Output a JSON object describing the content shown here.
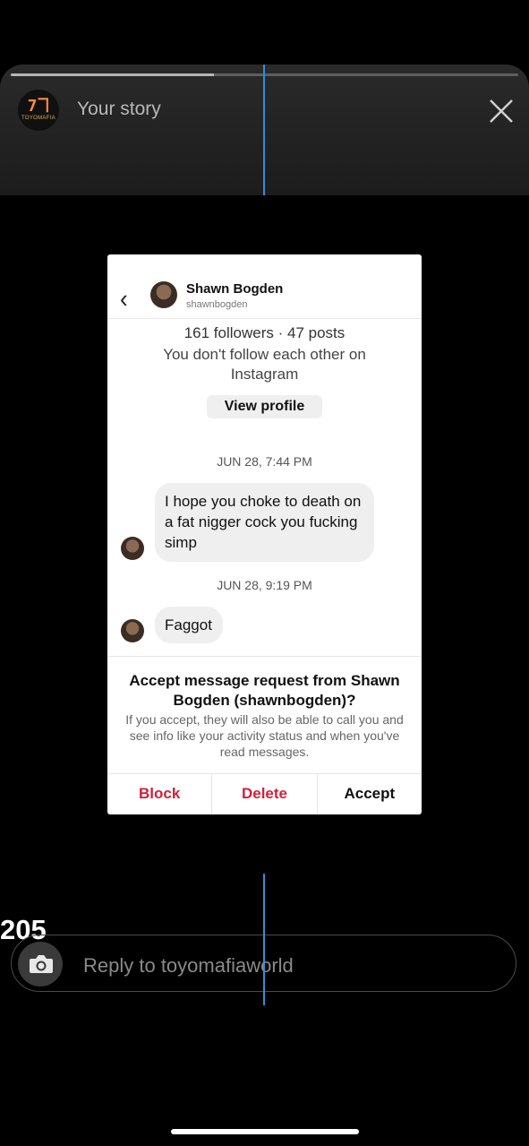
{
  "story": {
    "title": "Your story",
    "logo_mark": "7ヿ",
    "logo_text": "TOYOMAFIA",
    "progress": 0.4
  },
  "screenshot": {
    "contact_name": "Shawn Bogden",
    "contact_username": "shawnbogden",
    "stats": "161 followers · 47 posts",
    "follow_note": "You don't follow each other on Instagram",
    "view_profile_label": "View profile",
    "messages": [
      {
        "timestamp": "JUN 28, 7:44 PM",
        "text": "I hope you choke to death on a fat nigger cock you fucking simp"
      },
      {
        "timestamp": "JUN 28, 9:19 PM",
        "text": "Faggot"
      }
    ],
    "accept_title": "Accept message request from Shawn Bogden (shawnbogden)?",
    "accept_description": "If you accept, they will also be able to call you and see info like your activity status and when you've read messages.",
    "actions": {
      "block": "Block",
      "delete": "Delete",
      "accept": "Accept"
    },
    "danger_color": "#d0213a"
  },
  "counter": "205",
  "reply": {
    "placeholder": "Reply to toyomafiaworld"
  },
  "icons": {
    "close": "close-icon",
    "camera": "camera-icon",
    "back": "chevron-left-icon"
  }
}
